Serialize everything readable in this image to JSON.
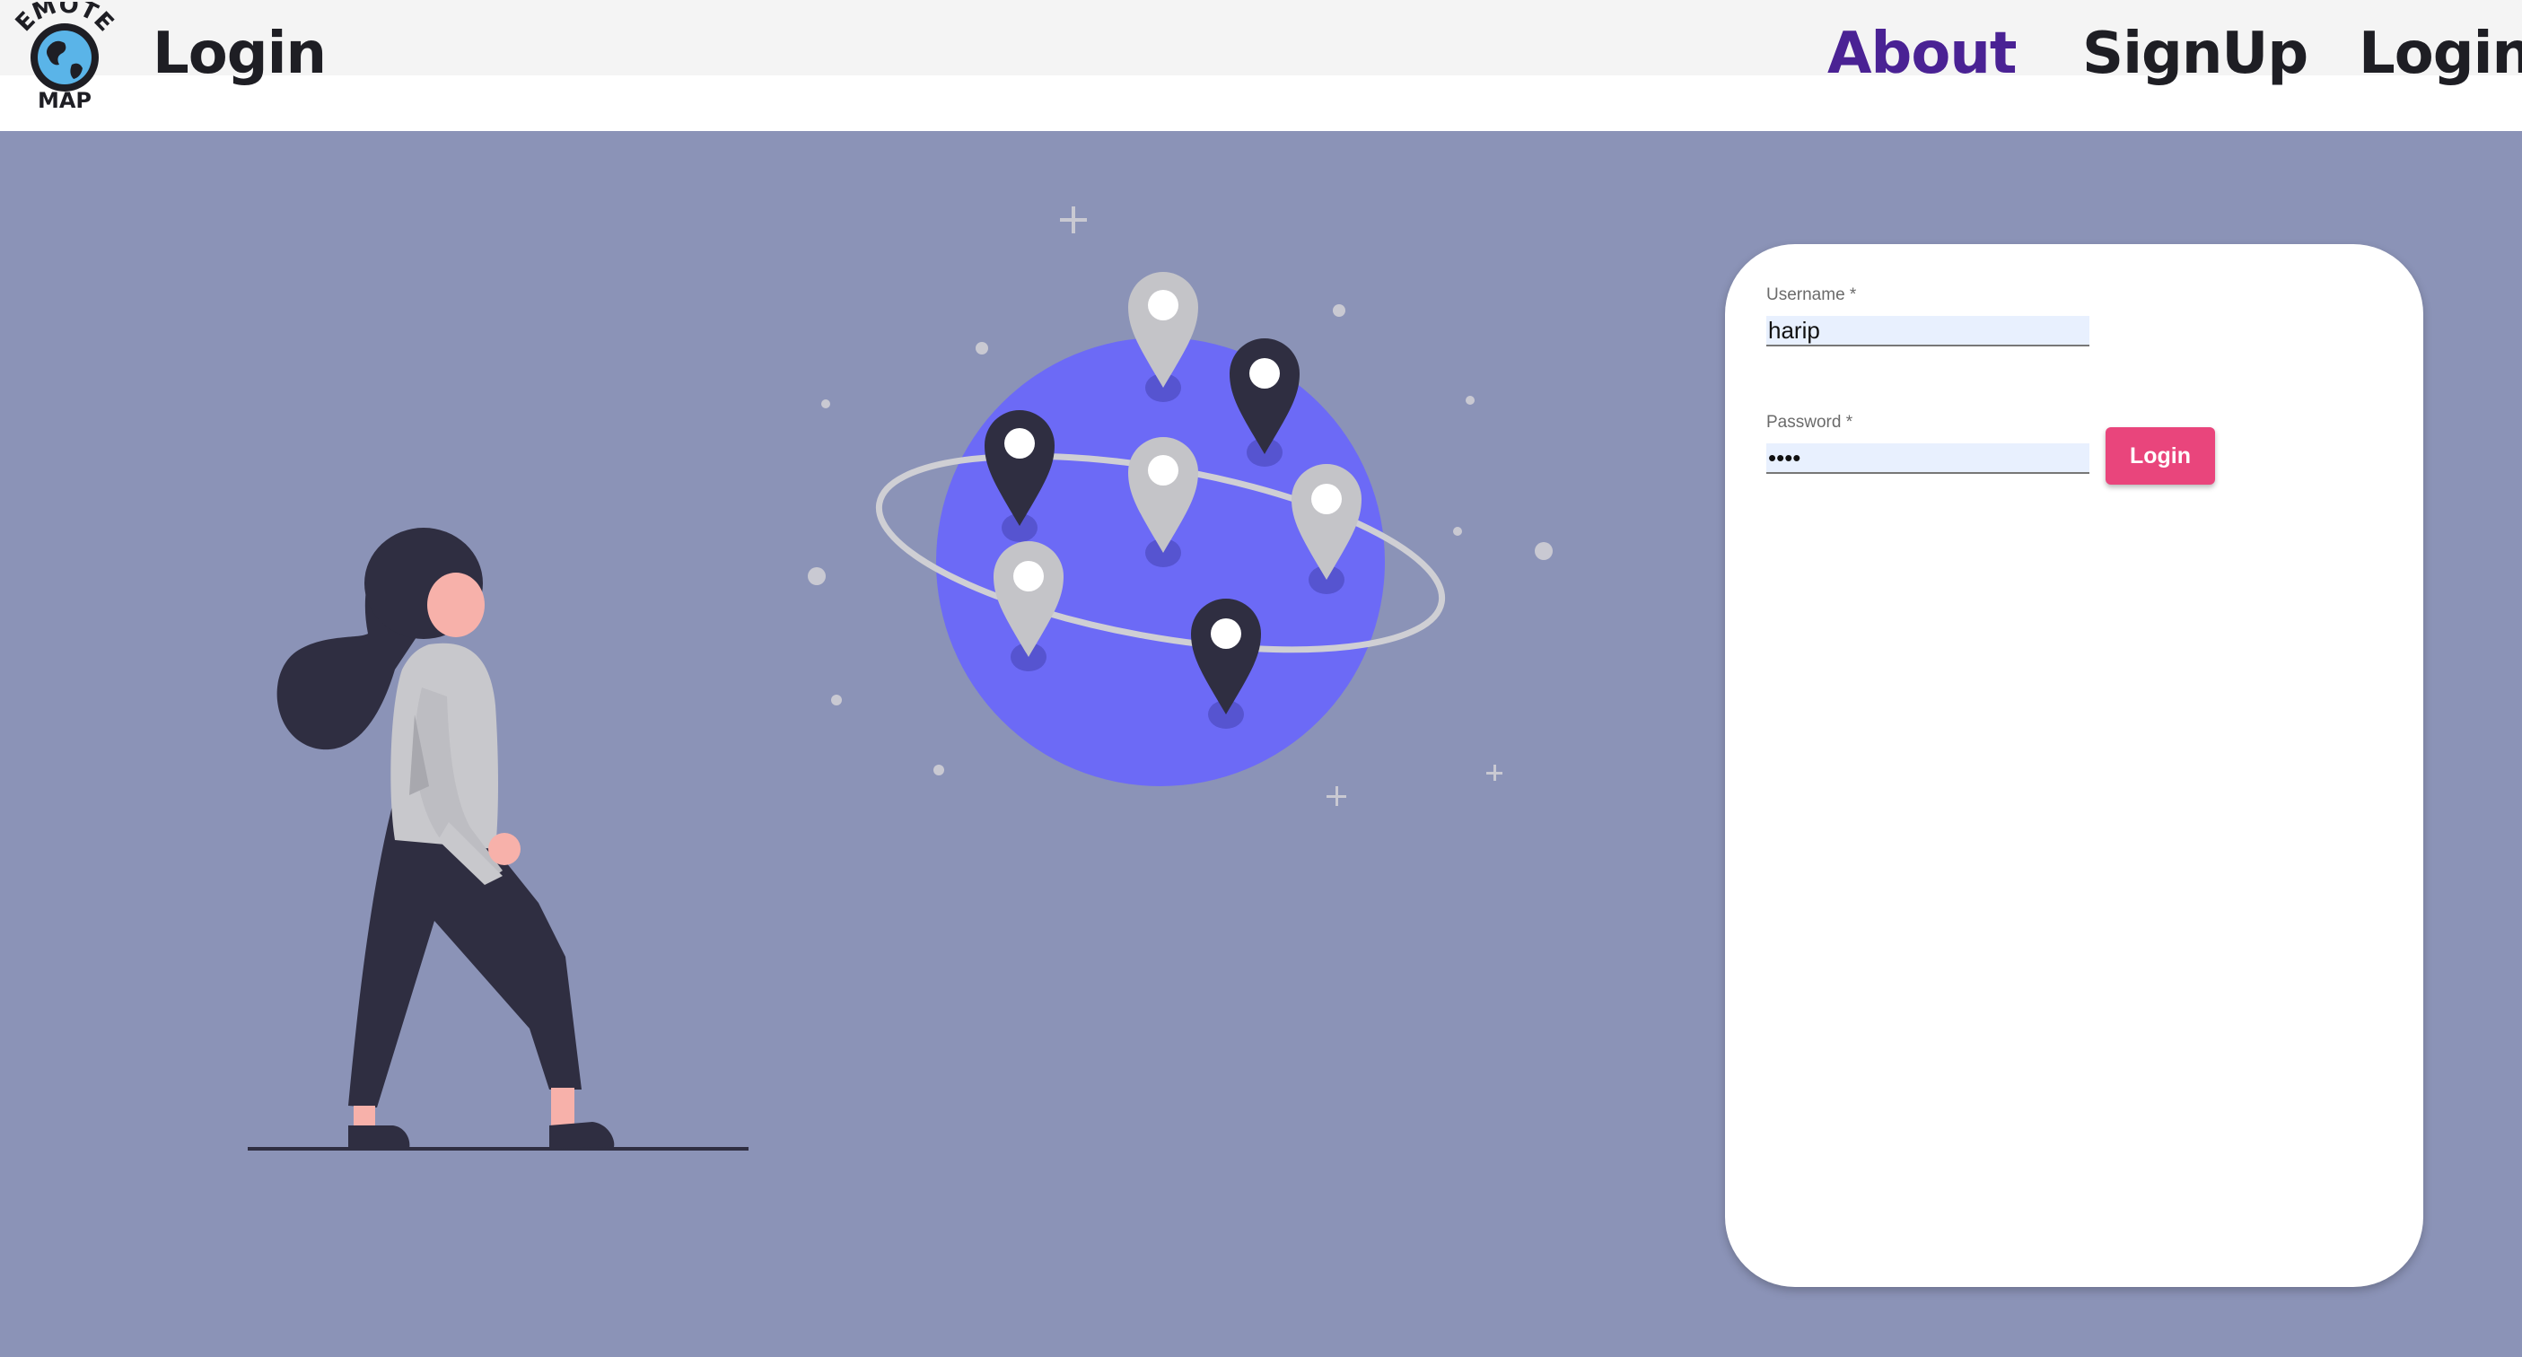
{
  "header": {
    "title": "Login",
    "logo_icon": "globe-logo-icon",
    "logo_text_top": "EMOTE",
    "logo_text_bottom": "MAP",
    "nav": [
      {
        "label": "About",
        "color": "#4a2294"
      },
      {
        "label": "SignUp",
        "color": "#1e1e24"
      },
      {
        "label": "Login",
        "color": "#1e1e24"
      }
    ]
  },
  "login_form": {
    "username_label": "Username *",
    "username_value": "harip",
    "password_label": "Password *",
    "password_value": "••••",
    "submit_label": "Login"
  },
  "colors": {
    "background": "#8b93b7",
    "accent_button": "#e9457c",
    "globe": "#6c6af6"
  },
  "illustration": {
    "icons": [
      "woman-figure-icon",
      "globe-icon",
      "location-pin-icon"
    ]
  }
}
